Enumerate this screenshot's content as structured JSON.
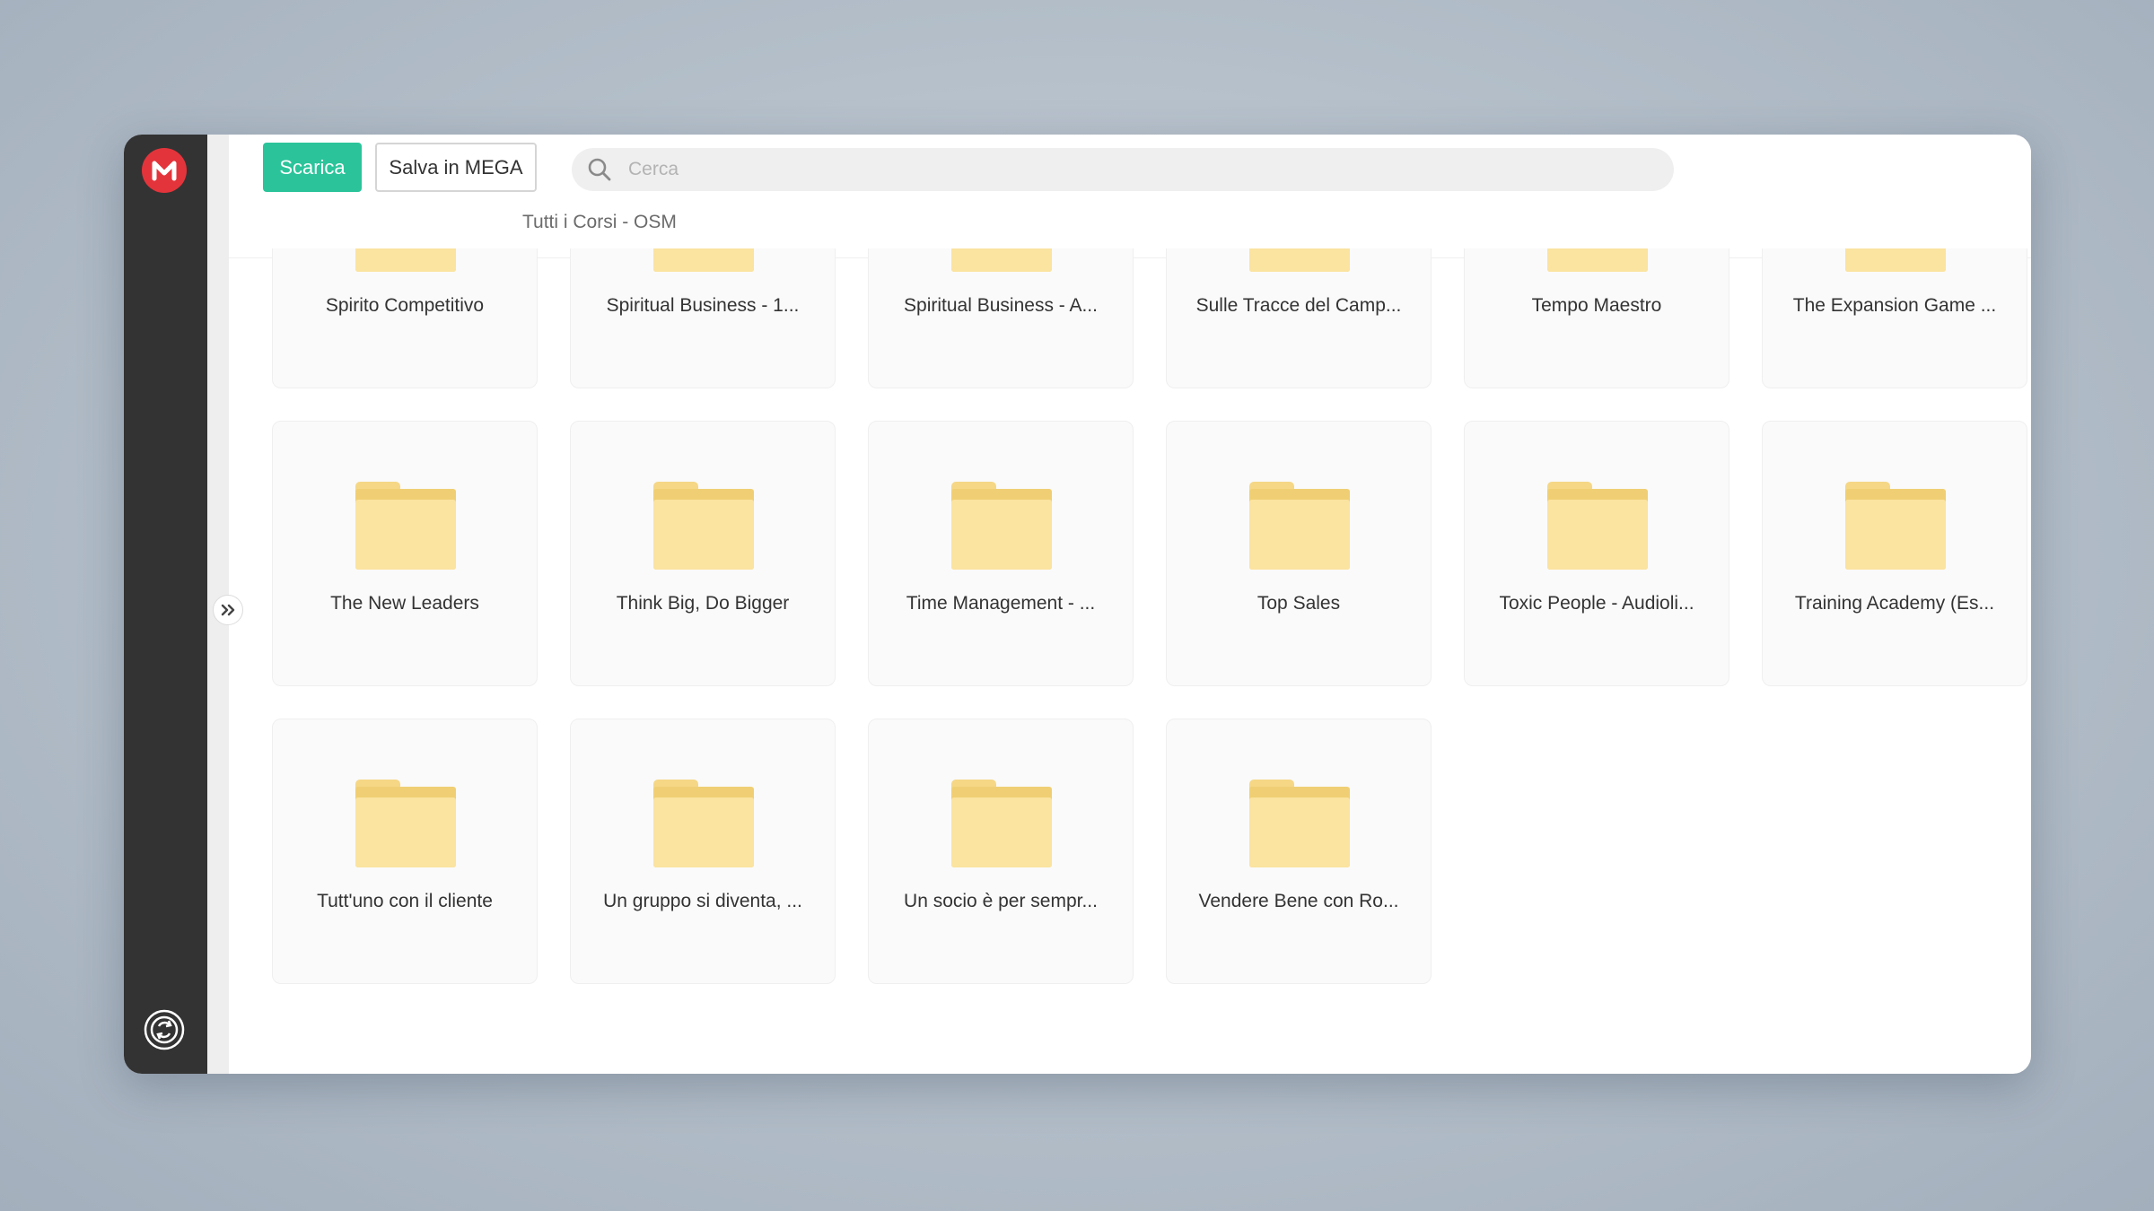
{
  "app": {
    "logo_letter": "M"
  },
  "toolbar": {
    "download_label": "Scarica",
    "save_label": "Salva in MEGA"
  },
  "search": {
    "placeholder": "Cerca",
    "value": ""
  },
  "breadcrumb": "Tutti i Corsi - OSM",
  "colors": {
    "accent": "#2bc49a",
    "logo": "#e4343b",
    "sidebar": "#333333",
    "folder": "#fbe3a0"
  },
  "icons": {
    "logo": "mega-logo-icon",
    "search": "search-icon",
    "expand": "chevron-double-right-icon",
    "sync": "sync-icon",
    "folder": "folder-icon"
  },
  "folders": [
    {
      "label": "Spirito Competitivo"
    },
    {
      "label": "Spiritual Business - 1..."
    },
    {
      "label": "Spiritual Business - A..."
    },
    {
      "label": "Sulle Tracce del Camp..."
    },
    {
      "label": "Tempo Maestro"
    },
    {
      "label": "The Expansion Game ..."
    },
    {
      "label": "The New Leaders"
    },
    {
      "label": "Think Big, Do Bigger"
    },
    {
      "label": "Time Management - ..."
    },
    {
      "label": "Top Sales"
    },
    {
      "label": "Toxic People - Audioli..."
    },
    {
      "label": "Training Academy (Es..."
    },
    {
      "label": "Tutt'uno con il cliente"
    },
    {
      "label": "Un gruppo si diventa, ..."
    },
    {
      "label": "Un socio è per sempr..."
    },
    {
      "label": "Vendere Bene con Ro..."
    }
  ]
}
